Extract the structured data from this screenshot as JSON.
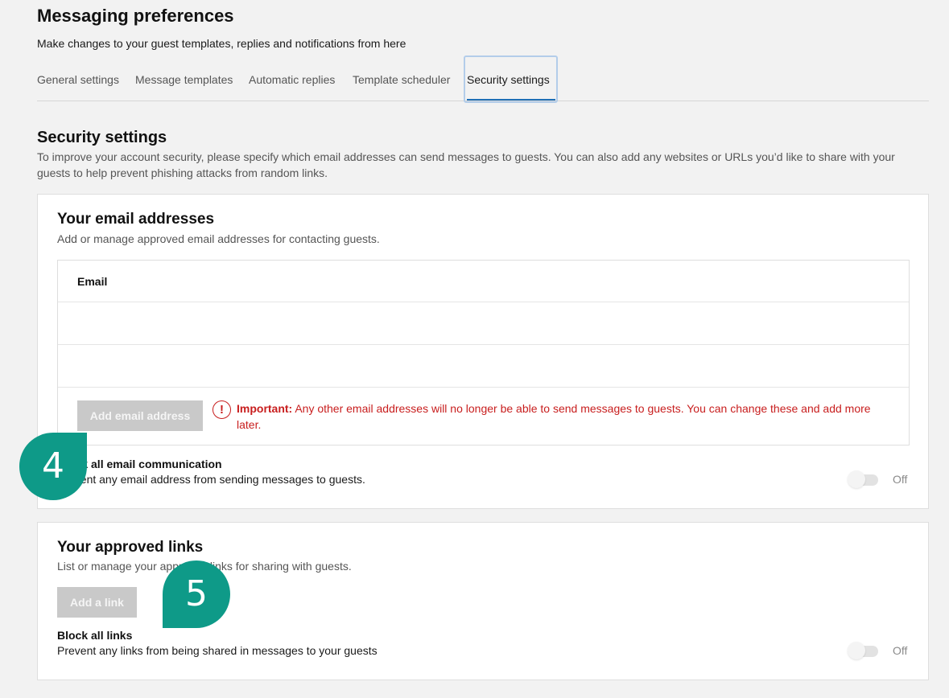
{
  "header": {
    "title": "Messaging preferences",
    "subtitle": "Make changes to your guest templates, replies and notifications from here"
  },
  "tabs": [
    {
      "label": "General settings"
    },
    {
      "label": "Message templates"
    },
    {
      "label": "Automatic replies"
    },
    {
      "label": "Template scheduler"
    },
    {
      "label": "Security settings",
      "active": true
    }
  ],
  "security": {
    "title": "Security settings",
    "description": "To improve your account security, please specify which email addresses can send messages to guests. You can also add any websites or URLs you’d like to share with your guests to help prevent phishing attacks from random links."
  },
  "email_card": {
    "title": "Your email addresses",
    "description": "Add or manage approved email addresses for contacting guests.",
    "table_header": "Email",
    "rows": [
      "",
      ""
    ],
    "add_button": "Add email address",
    "warning_strong": "Important:",
    "warning_text": " Any other email addresses will no longer be able to send messages to guests. You can change these and add more later.",
    "block_label": "Block all email communication",
    "block_desc": "Prevent any email address from sending messages to guests.",
    "toggle_state": "Off"
  },
  "links_card": {
    "title": "Your approved links",
    "description": "List or manage your approved links for sharing with guests.",
    "add_button": "Add a link",
    "block_label": "Block all links",
    "block_desc": "Prevent any links from being shared in messages to your guests",
    "toggle_state": "Off"
  },
  "callouts": {
    "step_4": "4",
    "step_5": "5"
  },
  "colors": {
    "accent_tab": "#1f6fb5",
    "warning": "#c81e1e",
    "callout": "#0e9a88",
    "disabled_button": "#c9c9c9"
  }
}
